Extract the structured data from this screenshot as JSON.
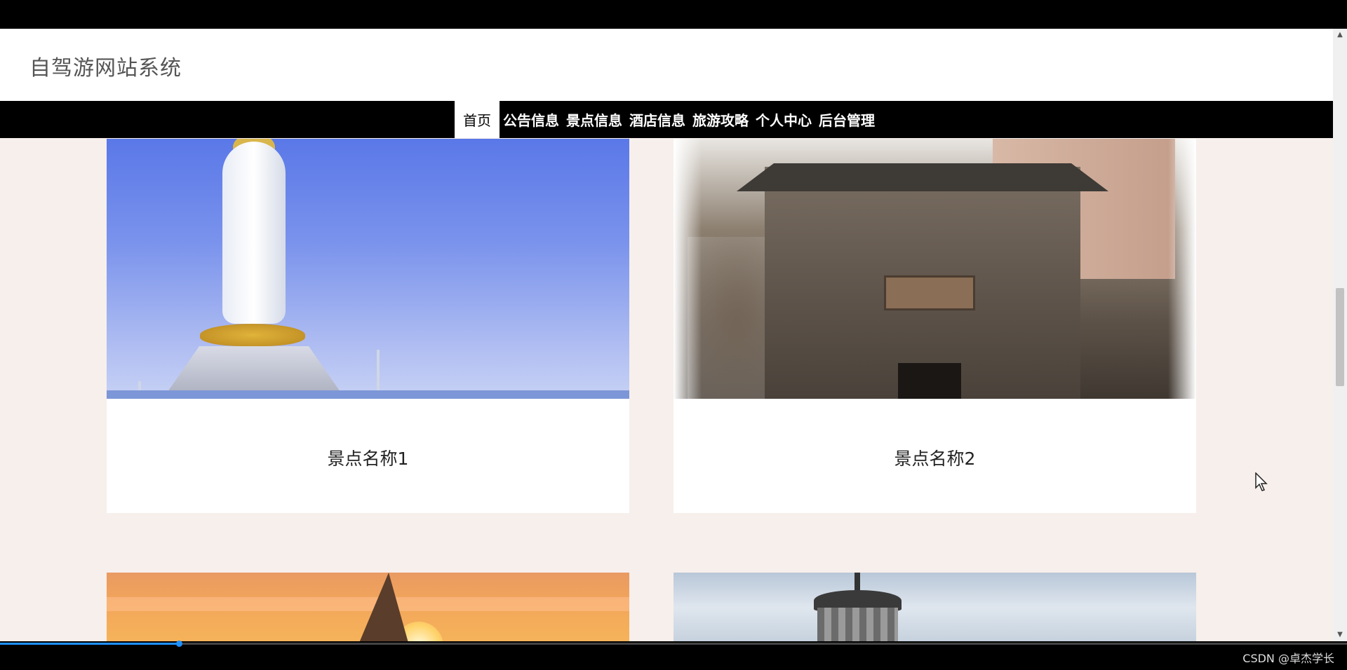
{
  "header": {
    "site_title": "自驾游网站系统"
  },
  "nav": {
    "items": [
      {
        "label": "首页",
        "active": true
      },
      {
        "label": "公告信息",
        "active": false
      },
      {
        "label": "景点信息",
        "active": false
      },
      {
        "label": "酒店信息",
        "active": false
      },
      {
        "label": "旅游攻略",
        "active": false
      },
      {
        "label": "个人中心",
        "active": false
      },
      {
        "label": "后台管理",
        "active": false
      }
    ]
  },
  "attractions": [
    {
      "name": "景点名称1",
      "image": "statue-photo"
    },
    {
      "name": "景点名称2",
      "image": "ancient-gate-photo"
    },
    {
      "name": "",
      "image": "sunset-sail-photo"
    },
    {
      "name": "",
      "image": "tower-photo"
    }
  ],
  "video": {
    "progress": 0.133
  },
  "watermark": "CSDN @卓杰学长",
  "colors": {
    "page_bg": "#f7efeb",
    "nav_bg": "#000000",
    "active_nav_bg": "#ffffff",
    "progress": "#1e90ff"
  }
}
